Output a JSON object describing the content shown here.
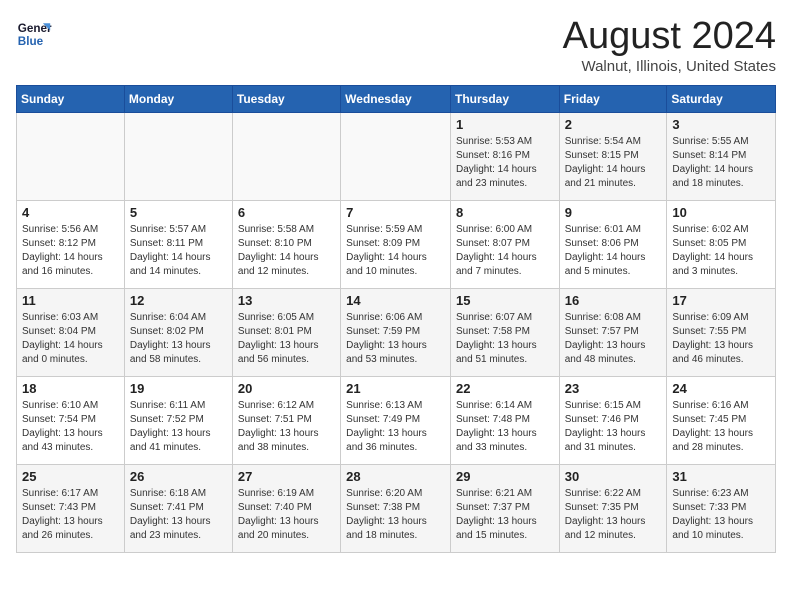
{
  "header": {
    "logo_line1": "General",
    "logo_line2": "Blue",
    "main_title": "August 2024",
    "subtitle": "Walnut, Illinois, United States"
  },
  "weekdays": [
    "Sunday",
    "Monday",
    "Tuesday",
    "Wednesday",
    "Thursday",
    "Friday",
    "Saturday"
  ],
  "weeks": [
    [
      {
        "day": "",
        "info": ""
      },
      {
        "day": "",
        "info": ""
      },
      {
        "day": "",
        "info": ""
      },
      {
        "day": "",
        "info": ""
      },
      {
        "day": "1",
        "info": "Sunrise: 5:53 AM\nSunset: 8:16 PM\nDaylight: 14 hours\nand 23 minutes."
      },
      {
        "day": "2",
        "info": "Sunrise: 5:54 AM\nSunset: 8:15 PM\nDaylight: 14 hours\nand 21 minutes."
      },
      {
        "day": "3",
        "info": "Sunrise: 5:55 AM\nSunset: 8:14 PM\nDaylight: 14 hours\nand 18 minutes."
      }
    ],
    [
      {
        "day": "4",
        "info": "Sunrise: 5:56 AM\nSunset: 8:12 PM\nDaylight: 14 hours\nand 16 minutes."
      },
      {
        "day": "5",
        "info": "Sunrise: 5:57 AM\nSunset: 8:11 PM\nDaylight: 14 hours\nand 14 minutes."
      },
      {
        "day": "6",
        "info": "Sunrise: 5:58 AM\nSunset: 8:10 PM\nDaylight: 14 hours\nand 12 minutes."
      },
      {
        "day": "7",
        "info": "Sunrise: 5:59 AM\nSunset: 8:09 PM\nDaylight: 14 hours\nand 10 minutes."
      },
      {
        "day": "8",
        "info": "Sunrise: 6:00 AM\nSunset: 8:07 PM\nDaylight: 14 hours\nand 7 minutes."
      },
      {
        "day": "9",
        "info": "Sunrise: 6:01 AM\nSunset: 8:06 PM\nDaylight: 14 hours\nand 5 minutes."
      },
      {
        "day": "10",
        "info": "Sunrise: 6:02 AM\nSunset: 8:05 PM\nDaylight: 14 hours\nand 3 minutes."
      }
    ],
    [
      {
        "day": "11",
        "info": "Sunrise: 6:03 AM\nSunset: 8:04 PM\nDaylight: 14 hours\nand 0 minutes."
      },
      {
        "day": "12",
        "info": "Sunrise: 6:04 AM\nSunset: 8:02 PM\nDaylight: 13 hours\nand 58 minutes."
      },
      {
        "day": "13",
        "info": "Sunrise: 6:05 AM\nSunset: 8:01 PM\nDaylight: 13 hours\nand 56 minutes."
      },
      {
        "day": "14",
        "info": "Sunrise: 6:06 AM\nSunset: 7:59 PM\nDaylight: 13 hours\nand 53 minutes."
      },
      {
        "day": "15",
        "info": "Sunrise: 6:07 AM\nSunset: 7:58 PM\nDaylight: 13 hours\nand 51 minutes."
      },
      {
        "day": "16",
        "info": "Sunrise: 6:08 AM\nSunset: 7:57 PM\nDaylight: 13 hours\nand 48 minutes."
      },
      {
        "day": "17",
        "info": "Sunrise: 6:09 AM\nSunset: 7:55 PM\nDaylight: 13 hours\nand 46 minutes."
      }
    ],
    [
      {
        "day": "18",
        "info": "Sunrise: 6:10 AM\nSunset: 7:54 PM\nDaylight: 13 hours\nand 43 minutes."
      },
      {
        "day": "19",
        "info": "Sunrise: 6:11 AM\nSunset: 7:52 PM\nDaylight: 13 hours\nand 41 minutes."
      },
      {
        "day": "20",
        "info": "Sunrise: 6:12 AM\nSunset: 7:51 PM\nDaylight: 13 hours\nand 38 minutes."
      },
      {
        "day": "21",
        "info": "Sunrise: 6:13 AM\nSunset: 7:49 PM\nDaylight: 13 hours\nand 36 minutes."
      },
      {
        "day": "22",
        "info": "Sunrise: 6:14 AM\nSunset: 7:48 PM\nDaylight: 13 hours\nand 33 minutes."
      },
      {
        "day": "23",
        "info": "Sunrise: 6:15 AM\nSunset: 7:46 PM\nDaylight: 13 hours\nand 31 minutes."
      },
      {
        "day": "24",
        "info": "Sunrise: 6:16 AM\nSunset: 7:45 PM\nDaylight: 13 hours\nand 28 minutes."
      }
    ],
    [
      {
        "day": "25",
        "info": "Sunrise: 6:17 AM\nSunset: 7:43 PM\nDaylight: 13 hours\nand 26 minutes."
      },
      {
        "day": "26",
        "info": "Sunrise: 6:18 AM\nSunset: 7:41 PM\nDaylight: 13 hours\nand 23 minutes."
      },
      {
        "day": "27",
        "info": "Sunrise: 6:19 AM\nSunset: 7:40 PM\nDaylight: 13 hours\nand 20 minutes."
      },
      {
        "day": "28",
        "info": "Sunrise: 6:20 AM\nSunset: 7:38 PM\nDaylight: 13 hours\nand 18 minutes."
      },
      {
        "day": "29",
        "info": "Sunrise: 6:21 AM\nSunset: 7:37 PM\nDaylight: 13 hours\nand 15 minutes."
      },
      {
        "day": "30",
        "info": "Sunrise: 6:22 AM\nSunset: 7:35 PM\nDaylight: 13 hours\nand 12 minutes."
      },
      {
        "day": "31",
        "info": "Sunrise: 6:23 AM\nSunset: 7:33 PM\nDaylight: 13 hours\nand 10 minutes."
      }
    ]
  ]
}
